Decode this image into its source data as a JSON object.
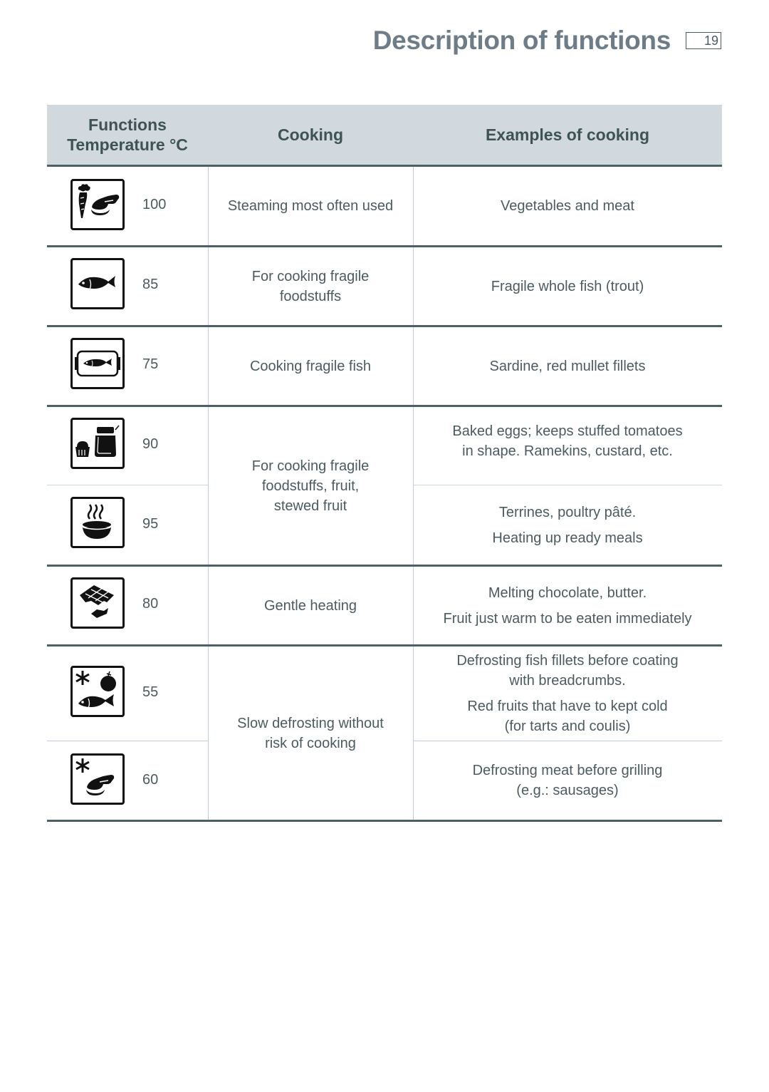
{
  "header": {
    "title": "Description of functions",
    "page_number": "19"
  },
  "table": {
    "columns": {
      "functions_line1": "Functions",
      "functions_line2": "Temperature °C",
      "cooking": "Cooking",
      "examples": "Examples of cooking"
    },
    "rows": [
      {
        "icon": "steam-vegetables-meat-icon",
        "temperature": "100",
        "cooking": "Steaming most often used",
        "examples": [
          "Vegetables and meat"
        ]
      },
      {
        "icon": "fish-icon",
        "temperature": "85",
        "cooking": [
          "For cooking fragile",
          "foodstuffs"
        ],
        "examples": [
          "Fragile whole fish (trout)"
        ]
      },
      {
        "icon": "fish-dish-icon",
        "temperature": "75",
        "cooking": "Cooking fragile fish",
        "examples": [
          "Sardine, red mullet fillets"
        ]
      },
      {
        "icon": "ramekin-jar-icon",
        "temperature": "90",
        "examples": [
          "Baked eggs; keeps stuffed tomatoes",
          "in shape. Ramekins, custard, etc."
        ]
      },
      {
        "icon": "steaming-bowl-icon",
        "temperature": "95",
        "examples": [
          "Terrines, poultry pâté.",
          "Heating up ready meals"
        ]
      },
      {
        "icon": "chocolate-icon",
        "temperature": "80",
        "cooking": "Gentle heating",
        "examples": [
          "Melting chocolate, butter.",
          "Fruit just warm to be eaten immediately"
        ]
      },
      {
        "icon": "defrost-fish-fruit-icon",
        "temperature": "55",
        "examples": [
          "Defrosting fish fillets before coating",
          "with breadcrumbs.",
          "Red fruits that have to kept cold",
          "(for tarts  and coulis)"
        ]
      },
      {
        "icon": "defrost-meat-icon",
        "temperature": "60",
        "examples": [
          "Defrosting meat before grilling",
          "(e.g.: sausages)"
        ]
      }
    ],
    "merged_cooking": {
      "fragile_fruit": [
        "For cooking fragile",
        "foodstuffs, fruit,",
        "stewed fruit"
      ],
      "slow_defrost": [
        "Slow defrosting without",
        "risk of cooking"
      ]
    }
  }
}
